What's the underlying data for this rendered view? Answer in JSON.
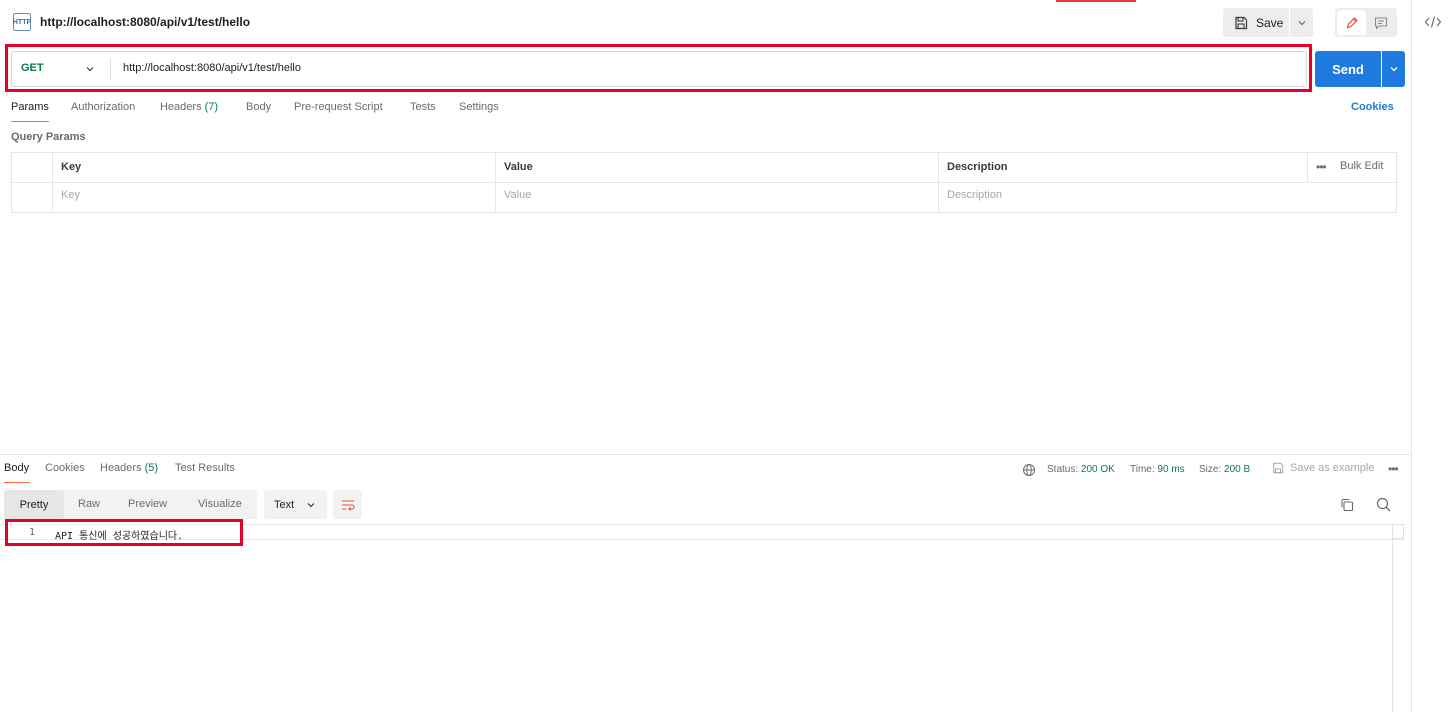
{
  "header": {
    "request_title": "http://localhost:8080/api/v1/test/hello",
    "http_icon_text": "HTTP",
    "save_label": "Save"
  },
  "url_bar": {
    "method": "GET",
    "url": "http://localhost:8080/api/v1/test/hello",
    "send_label": "Send"
  },
  "request_tabs": {
    "params": "Params",
    "authorization": "Authorization",
    "headers": "Headers",
    "headers_count": "(7)",
    "body": "Body",
    "pre_request": "Pre-request Script",
    "tests": "Tests",
    "settings": "Settings",
    "cookies": "Cookies"
  },
  "params": {
    "section_title": "Query Params",
    "columns": {
      "key": "Key",
      "value": "Value",
      "description": "Description"
    },
    "placeholders": {
      "key": "Key",
      "value": "Value",
      "description": "Description"
    },
    "bulk_edit": "Bulk Edit"
  },
  "response": {
    "tabs": {
      "body": "Body",
      "cookies": "Cookies",
      "headers": "Headers",
      "headers_count": "(5)",
      "test_results": "Test Results"
    },
    "status_label": "Status:",
    "status_value": "200 OK",
    "time_label": "Time:",
    "time_value": "90 ms",
    "size_label": "Size:",
    "size_value": "200 B",
    "save_example": "Save as example",
    "view_modes": [
      "Pretty",
      "Raw",
      "Preview",
      "Visualize"
    ],
    "format": "Text",
    "lines": [
      {
        "num": "1",
        "text": "API 통신에 성공하였습니다."
      }
    ]
  },
  "colors": {
    "accent_orange": "#ff6c37",
    "send_blue": "#1f7ae0",
    "success_green": "#0b7a45",
    "highlight_red": "#e5002b"
  }
}
